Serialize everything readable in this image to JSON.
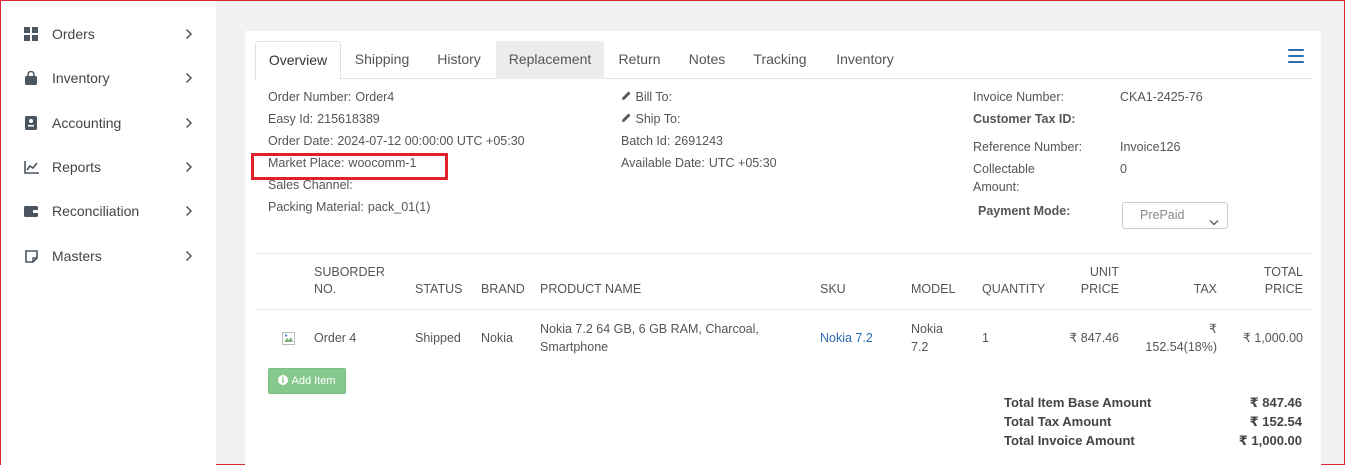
{
  "sidebar": {
    "items": [
      {
        "label": "Orders",
        "icon": "grid-icon"
      },
      {
        "label": "Inventory",
        "icon": "bag-icon"
      },
      {
        "label": "Accounting",
        "icon": "ledger-icon"
      },
      {
        "label": "Reports",
        "icon": "chart-icon"
      },
      {
        "label": "Reconciliation",
        "icon": "wallet-icon"
      },
      {
        "label": "Masters",
        "icon": "note-icon"
      }
    ]
  },
  "tabs": [
    "Overview",
    "Shipping",
    "History",
    "Replacement",
    "Return",
    "Notes",
    "Tracking",
    "Inventory"
  ],
  "order": {
    "order_number_label": "Order Number:",
    "order_number": "Order4",
    "easy_id_label": "Easy Id:",
    "easy_id": "215618389",
    "order_date_label": "Order Date:",
    "order_date": "2024-07-12 00:00:00 UTC +05:30",
    "market_place_label": "Market Place:",
    "market_place": "woocomm-1",
    "sales_channel_label": "Sales Channel:",
    "packing_label": "Packing Material:",
    "packing": "pack_01(1)"
  },
  "address": {
    "bill_to_label": "Bill To:",
    "ship_to_label": "Ship To:",
    "batch_label": "Batch Id:",
    "batch": "2691243",
    "available_label": "Available Date:",
    "available": "UTC +05:30"
  },
  "invoice": {
    "number_label": "Invoice Number:",
    "number": "CKA1-2425-76",
    "tax_id_label": "Customer Tax ID:",
    "ref_label": "Reference Number:",
    "ref": "Invoice126",
    "collectable_label_1": "Collectable",
    "collectable_label_2": "Amount:",
    "collectable": "0",
    "payment_label": "Payment Mode:",
    "payment": "PrePaid"
  },
  "table": {
    "headers": {
      "suborder_1": "SUBORDER",
      "suborder_2": "NO.",
      "status": "STATUS",
      "brand": "BRAND",
      "product": "PRODUCT NAME",
      "sku": "SKU",
      "model": "MODEL",
      "quantity": "QUANTITY",
      "unit_1": "UNIT",
      "unit_2": "PRICE",
      "tax": "TAX",
      "total_1": "TOTAL",
      "total_2": "PRICE"
    },
    "row": {
      "suborder": "Order 4",
      "status": "Shipped",
      "brand": "Nokia",
      "product_1": "Nokia 7.2 64 GB, 6 GB RAM, Charcoal,",
      "product_2": "Smartphone",
      "sku": "Nokia 7.2",
      "model_1": "Nokia",
      "model_2": "7.2",
      "quantity": "1",
      "unit_price": "₹ 847.46",
      "tax_1": "₹",
      "tax_2": "152.54(18%)",
      "total": "₹ 1,000.00"
    }
  },
  "add_item_label": "Add Item",
  "totals": {
    "base_label": "Total Item Base Amount",
    "base": "₹ 847.46",
    "tax_label": "Total Tax Amount",
    "tax": "₹ 152.54",
    "invoice_label": "Total Invoice Amount",
    "invoice": "₹ 1,000.00"
  },
  "colors": {
    "accent": "#2d6bb1",
    "highlight": "#e0202a",
    "add_button": "#86c98d"
  }
}
